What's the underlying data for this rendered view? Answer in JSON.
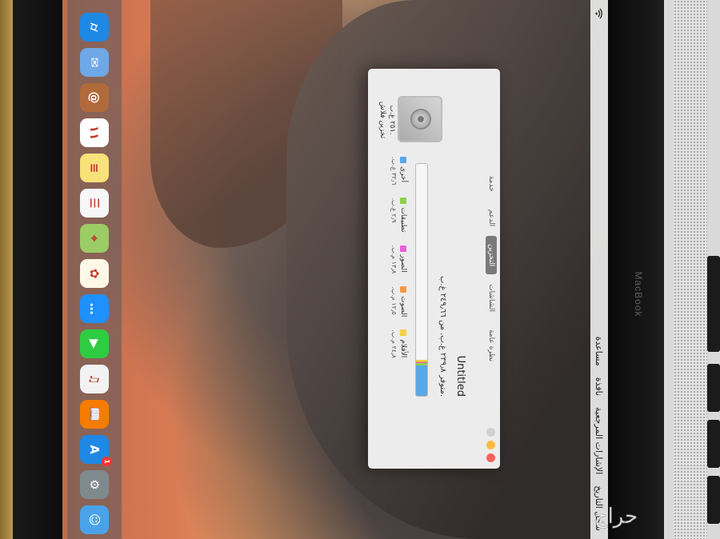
{
  "menubar": {
    "items": [
      "سجل التاريخ",
      "الإشارات المرجعية",
      "نافذة",
      "مساعدة"
    ],
    "wifi_icon": "wifi-icon"
  },
  "window": {
    "tabs": [
      {
        "label": "نظرة عامة",
        "active": false
      },
      {
        "label": "الشاشات",
        "active": false
      },
      {
        "label": "التخزين",
        "active": true
      },
      {
        "label": "الدعم",
        "active": false
      },
      {
        "label": "خدمة",
        "active": false
      }
    ],
    "disk": {
      "name": "Untitled",
      "availability": "متوفر ٢٣٩٫٨ غ.ب. من ٢٤٩٫٦٦ غ.ب.",
      "size": "٢٥١ غ.ب.",
      "type": "تخزين فلاش"
    },
    "storage": {
      "legend": [
        {
          "label": "أخرى",
          "size": "٣٢٫٦ غ.ب.",
          "color": "#5aa7e6",
          "fraction": 0.13
        },
        {
          "label": "تطبيقات",
          "size": "٢٫٩ غ.ب.",
          "color": "#8ed04e",
          "fraction": 0.012
        },
        {
          "label": "الصور",
          "size": "١٣٫٨ م.ب.",
          "color": "#e661d8",
          "fraction": 0.004
        },
        {
          "label": "الصوت",
          "size": "١٢٫٥ م.ب.",
          "color": "#f09a4a",
          "fraction": 0.004
        },
        {
          "label": "الأفلام",
          "size": "٢٤٫٨ م.ب.",
          "color": "#f1d33c",
          "fraction": 0.004
        }
      ]
    }
  },
  "dock": {
    "icons": [
      {
        "name": "finder-icon",
        "color": "#4aa3e8",
        "glyph": "☺",
        "badge": ""
      },
      {
        "name": "system-preferences-icon",
        "color": "#7f8a8f",
        "glyph": "⚙",
        "badge": ""
      },
      {
        "name": "app-store-icon",
        "color": "#1e88e5",
        "glyph": "A",
        "badge": "1"
      },
      {
        "name": "ibooks-icon",
        "color": "#f57c00",
        "glyph": "📖",
        "badge": ""
      },
      {
        "name": "itunes-icon",
        "color": "#f2f2f2",
        "glyph": "♫",
        "badge": ""
      },
      {
        "name": "facetime-icon",
        "color": "#2ecc40",
        "glyph": "▶",
        "badge": ""
      },
      {
        "name": "messages-icon",
        "color": "#1e90ff",
        "glyph": "…",
        "badge": ""
      },
      {
        "name": "photos-icon",
        "color": "#fff8e8",
        "glyph": "✿",
        "badge": ""
      },
      {
        "name": "maps-icon",
        "color": "#9ccc65",
        "glyph": "⌖",
        "badge": ""
      },
      {
        "name": "reminders-icon",
        "color": "#f7f7f7",
        "glyph": "☰",
        "badge": ""
      },
      {
        "name": "notes-icon",
        "color": "#f7e27a",
        "glyph": "≡",
        "badge": ""
      },
      {
        "name": "calendar-icon",
        "color": "#ffffff",
        "glyph": "١١",
        "badge": ""
      },
      {
        "name": "contacts-icon",
        "color": "#b06a3b",
        "glyph": "@",
        "badge": ""
      },
      {
        "name": "mail-icon",
        "color": "#6fa8e6",
        "glyph": "✉",
        "badge": ""
      },
      {
        "name": "safari-icon",
        "color": "#1e88e5",
        "glyph": "⌭",
        "badge": ""
      }
    ]
  },
  "device": {
    "brand": "MacBook"
  },
  "watermark": {
    "text": "حراج"
  }
}
